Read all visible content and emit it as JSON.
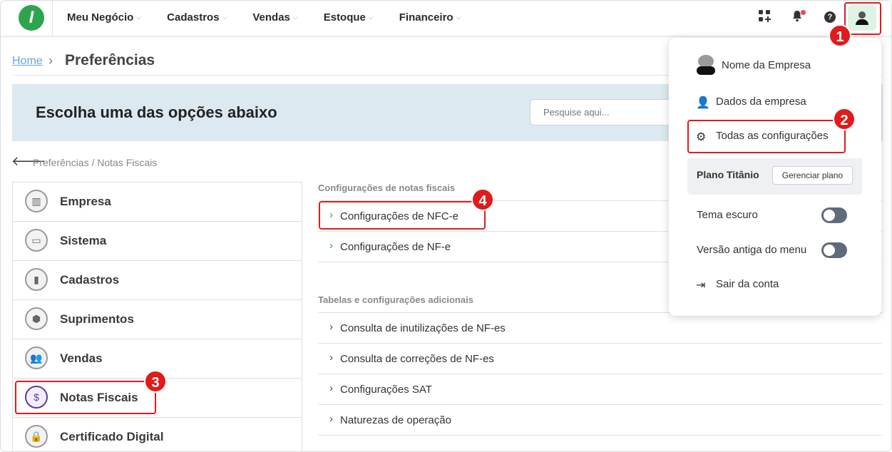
{
  "nav": {
    "logo": "I",
    "items": [
      {
        "label": "Meu Negócio"
      },
      {
        "label": "Cadastros"
      },
      {
        "label": "Vendas"
      },
      {
        "label": "Estoque"
      },
      {
        "label": "Financeiro"
      }
    ]
  },
  "breadcrumb": {
    "home": "Home",
    "current": "Preferências"
  },
  "banner": {
    "title": "Escolha uma das opções abaixo",
    "search_placeholder": "Pesquise aqui..."
  },
  "subcrumb": "Preferências / Notas Fiscais",
  "menu": {
    "items": [
      {
        "label": "Empresa",
        "icon": "building-icon"
      },
      {
        "label": "Sistema",
        "icon": "monitor-icon"
      },
      {
        "label": "Cadastros",
        "icon": "book-icon"
      },
      {
        "label": "Suprimentos",
        "icon": "box-icon"
      },
      {
        "label": "Vendas",
        "icon": "users-icon"
      },
      {
        "label": "Notas Fiscais",
        "icon": "receipt-icon",
        "active": true
      },
      {
        "label": "Certificado Digital",
        "icon": "lock-icon"
      }
    ]
  },
  "content": {
    "section1": {
      "title": "Configurações de notas fiscais",
      "rows": [
        "Configurações de NFC-e",
        "Configurações de NF-e"
      ]
    },
    "section2": {
      "title": "Tabelas e configurações adicionais",
      "rows": [
        "Consulta de inutilizações de NF-es",
        "Consulta de correções de NF-es",
        "Configurações SAT",
        "Naturezas de operação"
      ]
    }
  },
  "dropdown": {
    "company": "Nome da Empresa",
    "company_data": "Dados da empresa",
    "all_settings": "Todas as configurações",
    "plan_name": "Plano Titânio",
    "plan_button": "Gerenciar plano",
    "dark_theme": "Tema escuro",
    "old_menu": "Versão antiga do menu",
    "logout": "Sair da conta"
  },
  "annotations": [
    "1",
    "2",
    "3",
    "4"
  ],
  "colors": {
    "accent": "#2ea44f",
    "highlight": "#e11b1b",
    "banner": "#dce9f0"
  }
}
